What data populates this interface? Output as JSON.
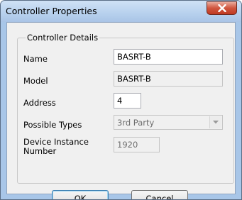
{
  "window": {
    "title": "Controller Properties"
  },
  "group": {
    "title": "Controller Details"
  },
  "fields": {
    "name": {
      "label": "Name",
      "value": "BASRT-B"
    },
    "model": {
      "label": "Model",
      "value": "BASRT-B"
    },
    "address": {
      "label": "Address",
      "value": "4"
    },
    "possible_types": {
      "label": "Possible Types",
      "value": "3rd Party"
    },
    "device_instance": {
      "label_line1": "Device Instance",
      "label_line2": "Number",
      "value": "1920"
    }
  },
  "buttons": {
    "ok": "OK",
    "cancel": "Cancel"
  },
  "icons": {
    "close": "close-icon",
    "dropdown": "chevron-down-icon"
  },
  "colors": {
    "close_button": "#c8442c",
    "title_bar": "#b9d2ee"
  }
}
